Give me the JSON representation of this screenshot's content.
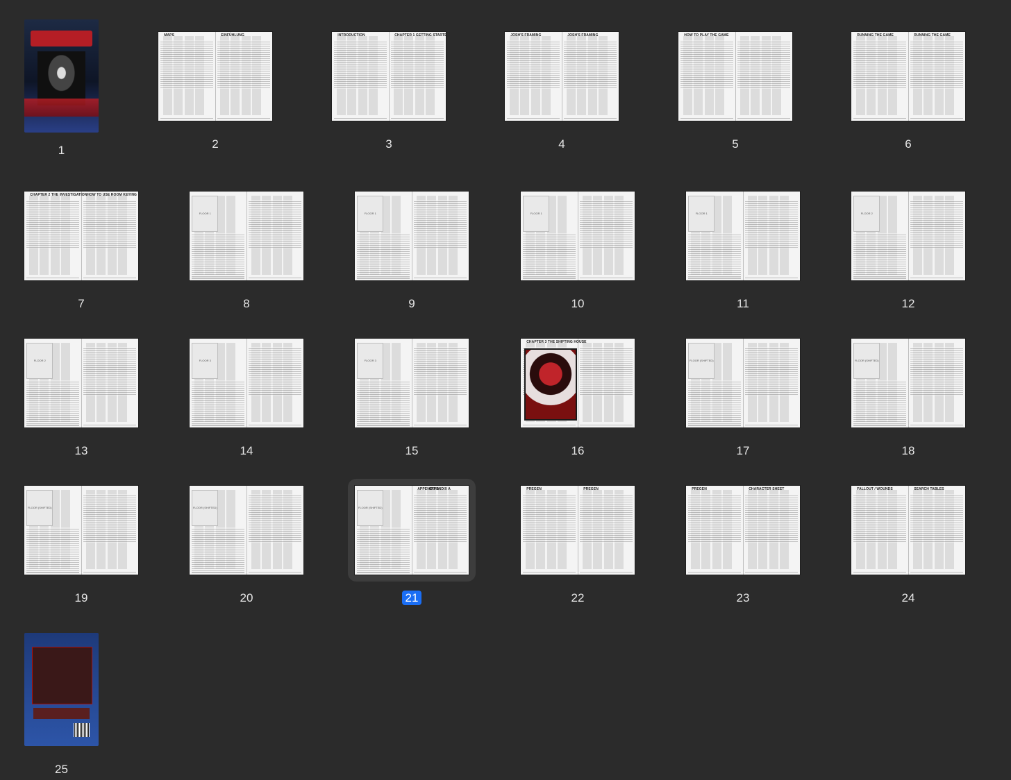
{
  "selected_page": "21",
  "pages": [
    {
      "n": "1",
      "kind": "cover"
    },
    {
      "n": "2",
      "left": "MAPS",
      "right": "EINFÜHLUNG"
    },
    {
      "n": "3",
      "left": "INTRODUCTION",
      "right": "CHAPTER 1 GETTING STARTED"
    },
    {
      "n": "4",
      "left": "JOSH'S FRAMING",
      "right": "JOSH'S FRAMING"
    },
    {
      "n": "5",
      "left": "HOW TO PLAY THE GAME",
      "right": ""
    },
    {
      "n": "6",
      "left": "RUNNING THE GAME",
      "right": "RUNNING THE GAME"
    },
    {
      "n": "7",
      "left": "CHAPTER 2 THE INVESTIGATION",
      "right": "HOW TO USE ROOM KEYING"
    },
    {
      "n": "8",
      "left": "FLOOR 1",
      "right": "",
      "map": true
    },
    {
      "n": "9",
      "left": "FLOOR 1",
      "right": "",
      "map": true
    },
    {
      "n": "10",
      "left": "FLOOR 1",
      "right": "",
      "map": true
    },
    {
      "n": "11",
      "left": "FLOOR 1",
      "right": "",
      "map": true
    },
    {
      "n": "12",
      "left": "FLOOR 2",
      "right": "",
      "map": true
    },
    {
      "n": "13",
      "left": "FLOOR 2",
      "right": "",
      "map": true
    },
    {
      "n": "14",
      "left": "FLOOR 3",
      "right": "",
      "map": true
    },
    {
      "n": "15",
      "left": "FLOOR 3",
      "right": "",
      "map": true
    },
    {
      "n": "16",
      "left": "CHAPTER 3 THE SHIFTING HOUSE",
      "right": "",
      "art": true
    },
    {
      "n": "17",
      "left": "FLOOR (SHIFTED)",
      "right": "",
      "map": true
    },
    {
      "n": "18",
      "left": "FLOOR (SHIFTED)",
      "right": "",
      "map": true
    },
    {
      "n": "19",
      "left": "FLOOR (SHIFTED)",
      "right": "",
      "map": true
    },
    {
      "n": "20",
      "left": "FLOOR (SHIFTED)",
      "right": "",
      "map": true
    },
    {
      "n": "21",
      "left": "FLOOR (SHIFTED)",
      "right": "APPENDIX A",
      "map": true
    },
    {
      "n": "22",
      "left": "PREGEN",
      "right": "PREGEN"
    },
    {
      "n": "23",
      "left": "PREGEN",
      "right": "CHARACTER SHEET"
    },
    {
      "n": "24",
      "left": "FALLOUT / WOUNDS",
      "right": "SEARCH TABLES"
    },
    {
      "n": "25",
      "kind": "back"
    }
  ],
  "colors": {
    "background": "#2b2b2b",
    "selection": "#1a6ef5"
  }
}
